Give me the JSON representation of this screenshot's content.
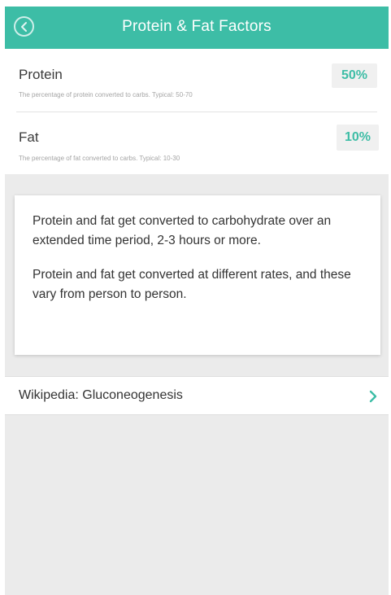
{
  "colors": {
    "accent": "#3dbda6",
    "background": "#ebebeb",
    "card": "#ffffff"
  },
  "header": {
    "title": "Protein & Fat Factors",
    "back_icon": "back-circle-icon"
  },
  "factors": {
    "protein": {
      "label": "Protein",
      "description": "The percentage of protein converted to carbs. Typical: 50-70",
      "value": "50%"
    },
    "fat": {
      "label": "Fat",
      "description": "The percentage of fat converted to carbs. Typical: 10-30",
      "value": "10%"
    }
  },
  "info": {
    "paragraph1": "Protein and fat get converted to carbohydrate over an extended time period, 2-3 hours or more.",
    "paragraph2": "Protein and fat get converted at different rates, and these vary from person to person."
  },
  "link": {
    "label": "Wikipedia: Gluconeogenesis",
    "icon": "chevron-right-icon"
  }
}
